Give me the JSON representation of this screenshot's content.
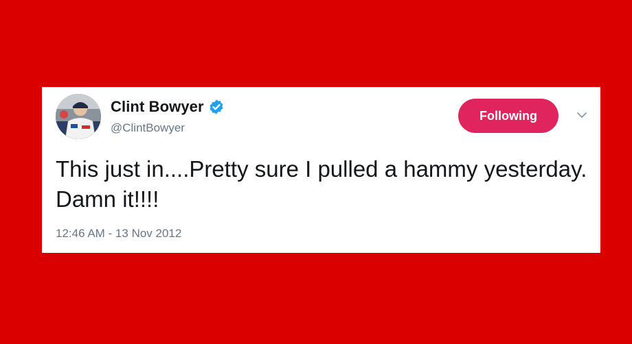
{
  "page": {
    "background_color": "#db0000"
  },
  "tweet": {
    "display_name": "Clint Bowyer",
    "handle": "@ClintBowyer",
    "verified": true,
    "follow_button_label": "Following",
    "follow_button_color": "#e0245e",
    "text": "This just in....Pretty sure I pulled a hammy yesterday. Damn it!!!!",
    "timestamp": "12:46 AM - 13 Nov 2012",
    "icons": {
      "avatar": "avatar",
      "verified": "verified-badge-icon",
      "menu": "chevron-down-icon"
    }
  }
}
